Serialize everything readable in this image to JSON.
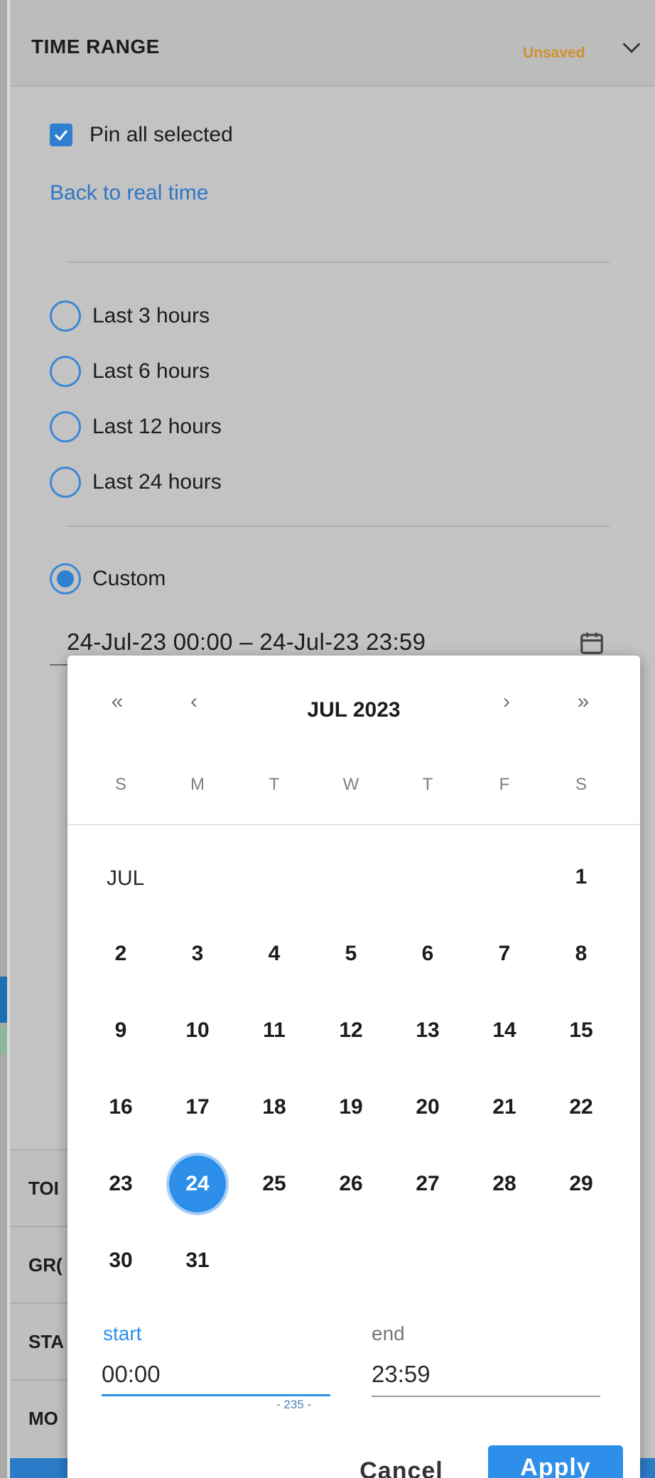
{
  "panel": {
    "title": "TIME RANGE",
    "status": "Unsaved",
    "pin_all_label": "Pin all selected",
    "pin_all_checked": true,
    "back_link": "Back to real time",
    "options": [
      {
        "label": "Last 3 hours",
        "selected": false
      },
      {
        "label": "Last 6 hours",
        "selected": false
      },
      {
        "label": "Last 12 hours",
        "selected": false
      },
      {
        "label": "Last 24 hours",
        "selected": false
      },
      {
        "label": "Custom",
        "selected": true
      }
    ],
    "range_value": "24-Jul-23 00:00 – 24-Jul-23 23:59",
    "truncated_sections": [
      "TOI",
      "GR(",
      "STA",
      "MO"
    ]
  },
  "calendar": {
    "nav": {
      "prev_year": "«",
      "prev_month": "‹",
      "next_month": "›",
      "next_year": "»"
    },
    "month_title": "JUL 2023",
    "weekdays": [
      "S",
      "M",
      "T",
      "W",
      "T",
      "F",
      "S"
    ],
    "month_label": "JUL",
    "first_weekday_index": 6,
    "days_in_month": 31,
    "selected_day": 24,
    "start_label": "start",
    "start_value": "00:00",
    "end_label": "end",
    "end_value": "23:59",
    "footnote": "- 235 -",
    "cancel_label": "Cancel",
    "apply_label": "Apply"
  },
  "colors": {
    "accent": "#2e8fea",
    "link": "#2e76c7",
    "unsaved": "#d0902d",
    "panel_bg": "#c3c3c3",
    "popup_bg": "#ffffff"
  },
  "icons": {
    "checkbox": "checkmark-icon",
    "collapse": "chevron-down-icon",
    "calendar": "calendar-icon"
  }
}
